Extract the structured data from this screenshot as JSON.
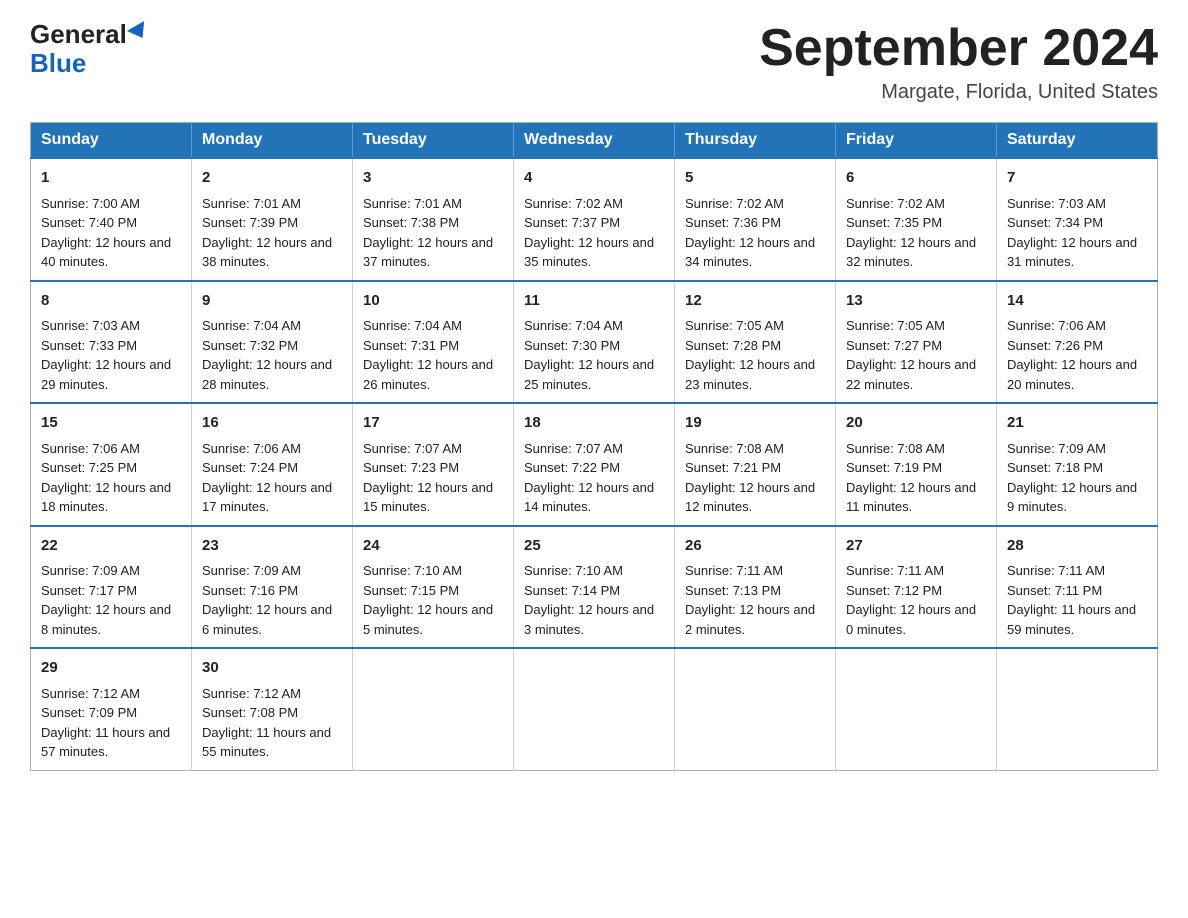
{
  "logo": {
    "general": "General",
    "blue": "Blue"
  },
  "title": {
    "month_year": "September 2024",
    "location": "Margate, Florida, United States"
  },
  "days_of_week": [
    "Sunday",
    "Monday",
    "Tuesday",
    "Wednesday",
    "Thursday",
    "Friday",
    "Saturday"
  ],
  "weeks": [
    [
      {
        "day": "1",
        "sunrise": "Sunrise: 7:00 AM",
        "sunset": "Sunset: 7:40 PM",
        "daylight": "Daylight: 12 hours and 40 minutes."
      },
      {
        "day": "2",
        "sunrise": "Sunrise: 7:01 AM",
        "sunset": "Sunset: 7:39 PM",
        "daylight": "Daylight: 12 hours and 38 minutes."
      },
      {
        "day": "3",
        "sunrise": "Sunrise: 7:01 AM",
        "sunset": "Sunset: 7:38 PM",
        "daylight": "Daylight: 12 hours and 37 minutes."
      },
      {
        "day": "4",
        "sunrise": "Sunrise: 7:02 AM",
        "sunset": "Sunset: 7:37 PM",
        "daylight": "Daylight: 12 hours and 35 minutes."
      },
      {
        "day": "5",
        "sunrise": "Sunrise: 7:02 AM",
        "sunset": "Sunset: 7:36 PM",
        "daylight": "Daylight: 12 hours and 34 minutes."
      },
      {
        "day": "6",
        "sunrise": "Sunrise: 7:02 AM",
        "sunset": "Sunset: 7:35 PM",
        "daylight": "Daylight: 12 hours and 32 minutes."
      },
      {
        "day": "7",
        "sunrise": "Sunrise: 7:03 AM",
        "sunset": "Sunset: 7:34 PM",
        "daylight": "Daylight: 12 hours and 31 minutes."
      }
    ],
    [
      {
        "day": "8",
        "sunrise": "Sunrise: 7:03 AM",
        "sunset": "Sunset: 7:33 PM",
        "daylight": "Daylight: 12 hours and 29 minutes."
      },
      {
        "day": "9",
        "sunrise": "Sunrise: 7:04 AM",
        "sunset": "Sunset: 7:32 PM",
        "daylight": "Daylight: 12 hours and 28 minutes."
      },
      {
        "day": "10",
        "sunrise": "Sunrise: 7:04 AM",
        "sunset": "Sunset: 7:31 PM",
        "daylight": "Daylight: 12 hours and 26 minutes."
      },
      {
        "day": "11",
        "sunrise": "Sunrise: 7:04 AM",
        "sunset": "Sunset: 7:30 PM",
        "daylight": "Daylight: 12 hours and 25 minutes."
      },
      {
        "day": "12",
        "sunrise": "Sunrise: 7:05 AM",
        "sunset": "Sunset: 7:28 PM",
        "daylight": "Daylight: 12 hours and 23 minutes."
      },
      {
        "day": "13",
        "sunrise": "Sunrise: 7:05 AM",
        "sunset": "Sunset: 7:27 PM",
        "daylight": "Daylight: 12 hours and 22 minutes."
      },
      {
        "day": "14",
        "sunrise": "Sunrise: 7:06 AM",
        "sunset": "Sunset: 7:26 PM",
        "daylight": "Daylight: 12 hours and 20 minutes."
      }
    ],
    [
      {
        "day": "15",
        "sunrise": "Sunrise: 7:06 AM",
        "sunset": "Sunset: 7:25 PM",
        "daylight": "Daylight: 12 hours and 18 minutes."
      },
      {
        "day": "16",
        "sunrise": "Sunrise: 7:06 AM",
        "sunset": "Sunset: 7:24 PM",
        "daylight": "Daylight: 12 hours and 17 minutes."
      },
      {
        "day": "17",
        "sunrise": "Sunrise: 7:07 AM",
        "sunset": "Sunset: 7:23 PM",
        "daylight": "Daylight: 12 hours and 15 minutes."
      },
      {
        "day": "18",
        "sunrise": "Sunrise: 7:07 AM",
        "sunset": "Sunset: 7:22 PM",
        "daylight": "Daylight: 12 hours and 14 minutes."
      },
      {
        "day": "19",
        "sunrise": "Sunrise: 7:08 AM",
        "sunset": "Sunset: 7:21 PM",
        "daylight": "Daylight: 12 hours and 12 minutes."
      },
      {
        "day": "20",
        "sunrise": "Sunrise: 7:08 AM",
        "sunset": "Sunset: 7:19 PM",
        "daylight": "Daylight: 12 hours and 11 minutes."
      },
      {
        "day": "21",
        "sunrise": "Sunrise: 7:09 AM",
        "sunset": "Sunset: 7:18 PM",
        "daylight": "Daylight: 12 hours and 9 minutes."
      }
    ],
    [
      {
        "day": "22",
        "sunrise": "Sunrise: 7:09 AM",
        "sunset": "Sunset: 7:17 PM",
        "daylight": "Daylight: 12 hours and 8 minutes."
      },
      {
        "day": "23",
        "sunrise": "Sunrise: 7:09 AM",
        "sunset": "Sunset: 7:16 PM",
        "daylight": "Daylight: 12 hours and 6 minutes."
      },
      {
        "day": "24",
        "sunrise": "Sunrise: 7:10 AM",
        "sunset": "Sunset: 7:15 PM",
        "daylight": "Daylight: 12 hours and 5 minutes."
      },
      {
        "day": "25",
        "sunrise": "Sunrise: 7:10 AM",
        "sunset": "Sunset: 7:14 PM",
        "daylight": "Daylight: 12 hours and 3 minutes."
      },
      {
        "day": "26",
        "sunrise": "Sunrise: 7:11 AM",
        "sunset": "Sunset: 7:13 PM",
        "daylight": "Daylight: 12 hours and 2 minutes."
      },
      {
        "day": "27",
        "sunrise": "Sunrise: 7:11 AM",
        "sunset": "Sunset: 7:12 PM",
        "daylight": "Daylight: 12 hours and 0 minutes."
      },
      {
        "day": "28",
        "sunrise": "Sunrise: 7:11 AM",
        "sunset": "Sunset: 7:11 PM",
        "daylight": "Daylight: 11 hours and 59 minutes."
      }
    ],
    [
      {
        "day": "29",
        "sunrise": "Sunrise: 7:12 AM",
        "sunset": "Sunset: 7:09 PM",
        "daylight": "Daylight: 11 hours and 57 minutes."
      },
      {
        "day": "30",
        "sunrise": "Sunrise: 7:12 AM",
        "sunset": "Sunset: 7:08 PM",
        "daylight": "Daylight: 11 hours and 55 minutes."
      },
      null,
      null,
      null,
      null,
      null
    ]
  ]
}
